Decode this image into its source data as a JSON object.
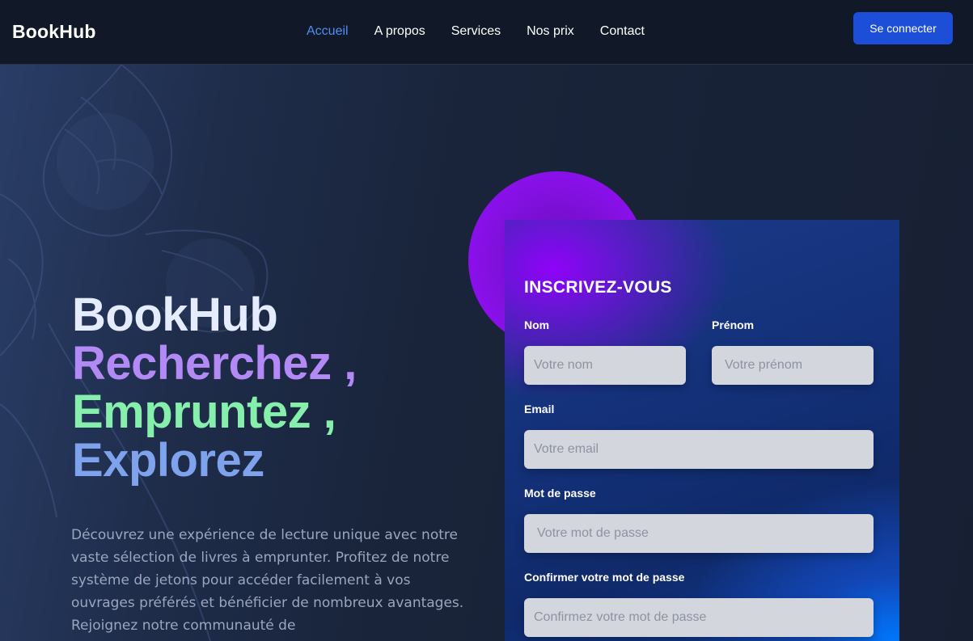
{
  "header": {
    "brand": "BookHub",
    "nav": [
      "Accueil",
      "A propos",
      "Services",
      "Nos prix",
      "Contact"
    ],
    "active_nav": "Accueil",
    "login_label": "Se connecter"
  },
  "hero": {
    "brand": "BookHub",
    "line1": "Recherchez ,",
    "line2": "Empruntez ,",
    "line3": "Explorez",
    "description": "Découvrez une expérience de lecture unique avec notre vaste sélection de livres à emprunter. Profitez de notre système de jetons pour accéder facilement à vos ouvrages préférés et bénéficier de nombreux avantages. Rejoignez notre communauté de"
  },
  "form": {
    "title": "INSCRIVEZ-VOUS",
    "nom_label": "Nom",
    "nom_placeholder": "Votre nom",
    "prenom_label": "Prénom",
    "prenom_placeholder": "Votre prénom",
    "email_label": "Email",
    "email_placeholder": "Votre email",
    "password_label": "Mot de passe",
    "password_placeholder": "Votre mot de passe",
    "confirm_label": "Confirmer votre mot de passe",
    "confirm_placeholder": "Confirmez votre mot de passe"
  },
  "colors": {
    "accent": "#1d4ed8",
    "nav_active": "#4f8df5",
    "line1": "#b38af5",
    "line2": "#86efac",
    "line3": "#7ea2ec",
    "header_bg": "#111827"
  }
}
